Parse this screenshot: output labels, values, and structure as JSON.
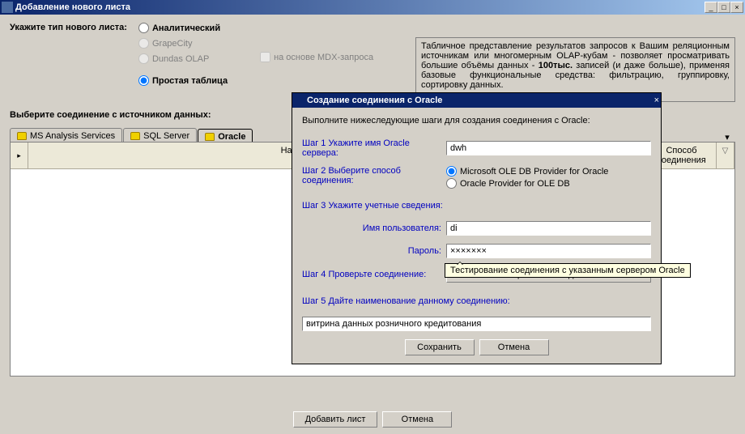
{
  "window": {
    "title": "Добавление нового листа",
    "minimize": "_",
    "maximize": "□",
    "close": "×"
  },
  "sheet_type_label": "Укажите тип нового листа:",
  "radios": {
    "analytical": "Аналитический",
    "grapecity": "GrapeCity",
    "dundas": "Dundas OLAP",
    "simple_table": "Простая таблица"
  },
  "mdx_checkbox": "на основе MDX-запроса",
  "description": {
    "text1": "Табличное представление результатов запросов к Вашим реляционным источникам или многомерным OLAP-кубам - позволяет просматривать большие объёмы данных - ",
    "bold": "100тыс.",
    "text2": " записей (и даже больше), применяя базовые функциональные средства: фильтрацию, группировку, сортировку данных."
  },
  "connection_label": "Выберите соединение с источником данных:",
  "tabs": {
    "ms_analysis": "MS Analysis Services",
    "sql_server": "SQL Server",
    "oracle": "Oracle",
    "dropdown": "▾"
  },
  "grid": {
    "col_name": "Наименование соединения",
    "col_method": "Способ соединения",
    "filter": "▽"
  },
  "bottom": {
    "add_sheet": "Добавить лист",
    "cancel": "Отмена"
  },
  "modal": {
    "title": "Создание соединения с Oracle",
    "close": "×",
    "intro": "Выполните нижеследующие шаги для создания соединения с Oracle:",
    "step1": "Шаг 1   Укажите имя Oracle сервера:",
    "server_value": "dwh",
    "step2": "Шаг 2   Выберите способ соединения:",
    "provider_ms": "Microsoft OLE DB Provider for Oracle",
    "provider_ora": "Oracle Provider for OLE DB",
    "step3": "Шаг 3   Укажите учетные сведения:",
    "user_label": "Имя пользователя:",
    "user_value": "di",
    "pass_label": "Пароль:",
    "pass_value": "×××××××",
    "step4": "Шаг 4   Проверьте соединение:",
    "test_btn": "Тестирование  соединения",
    "step5": "Шаг 5   Дайте наименование данному соединению:",
    "name_value": "витрина данных розничного кредитования",
    "save": "Сохранить",
    "cancel": "Отмена"
  },
  "tooltip": "Тестирование соединения с указанным сервером Oracle"
}
